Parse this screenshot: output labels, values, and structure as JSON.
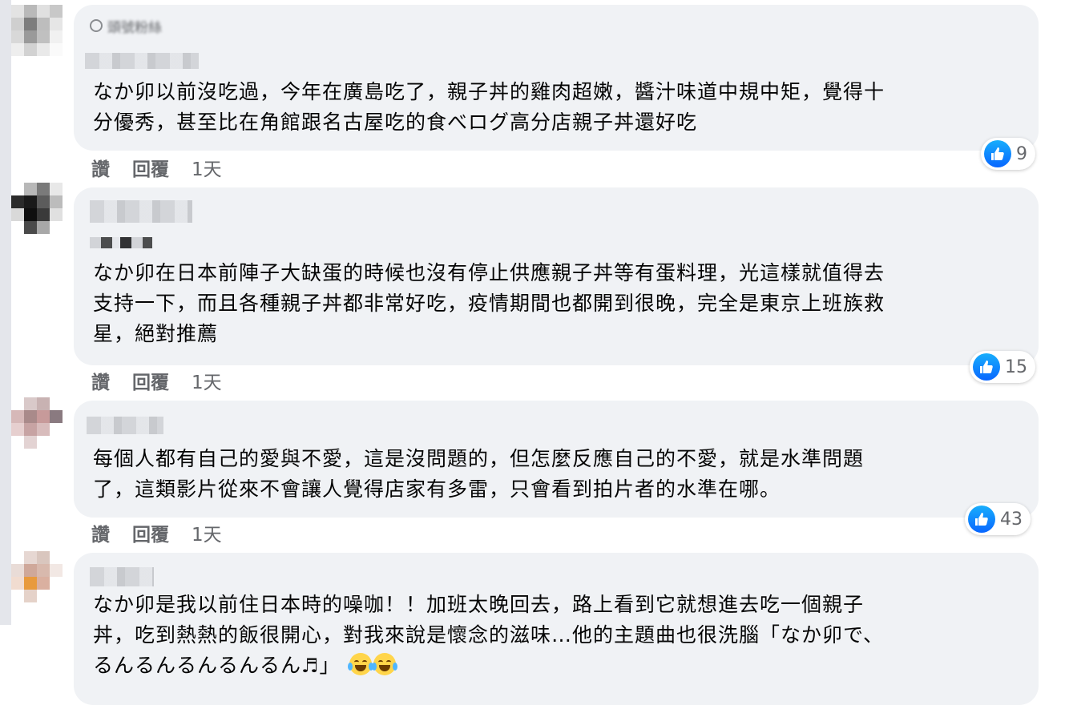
{
  "actions": {
    "like_label": "讚",
    "reply_label": "回覆"
  },
  "comments": [
    {
      "badge_label": "頭號粉絲",
      "text": "なか卯以前沒吃過，今年在廣島吃了，親子丼的雞肉超嫩，醬汁味道中規中矩，覺得十\n分優秀，甚至比在角館跟名古屋吃的食べログ高分店親子丼還好吃",
      "time": "1天",
      "reaction_count": "9",
      "reaction_type": "like-icon"
    },
    {
      "text": "なか卯在日本前陣子大缺蛋的時候也沒有停止供應親子丼等有蛋料理，光這樣就值得去\n支持一下，而且各種親子丼都非常好吃，疫情期間也都開到很晚，完全是東京上班族救\n星，絕對推薦",
      "time": "1天",
      "reaction_count": "15",
      "reaction_type": "like-icon"
    },
    {
      "text": "每個人都有自己的愛與不愛，這是沒問題的，但怎麼反應自己的不愛，就是水準問題\n了，這類影片從來不會讓人覺得店家有多雷，只會看到拍片者的水準在哪。",
      "time": "1天",
      "reaction_count": "43",
      "reaction_type": "like-icon"
    },
    {
      "text": "なか卯是我以前住日本時的噪咖！！加班太晚回去，路上看到它就想進去吃一個親子\n丼，吃到熱熱的飯很開心，對我來說是懷念的滋味…他的主題曲也很洗腦「なか卯で、\nるんるんるんるんるん",
      "text_tail": "」",
      "trailing_icons": [
        "music-note-icon",
        "laughing-crying-emoji-icon",
        "laughing-crying-emoji-icon"
      ]
    }
  ],
  "colors": {
    "bubble_bg": "#f0f2f5",
    "like_blue": "#0866ff",
    "meta_gray": "#65676b"
  }
}
